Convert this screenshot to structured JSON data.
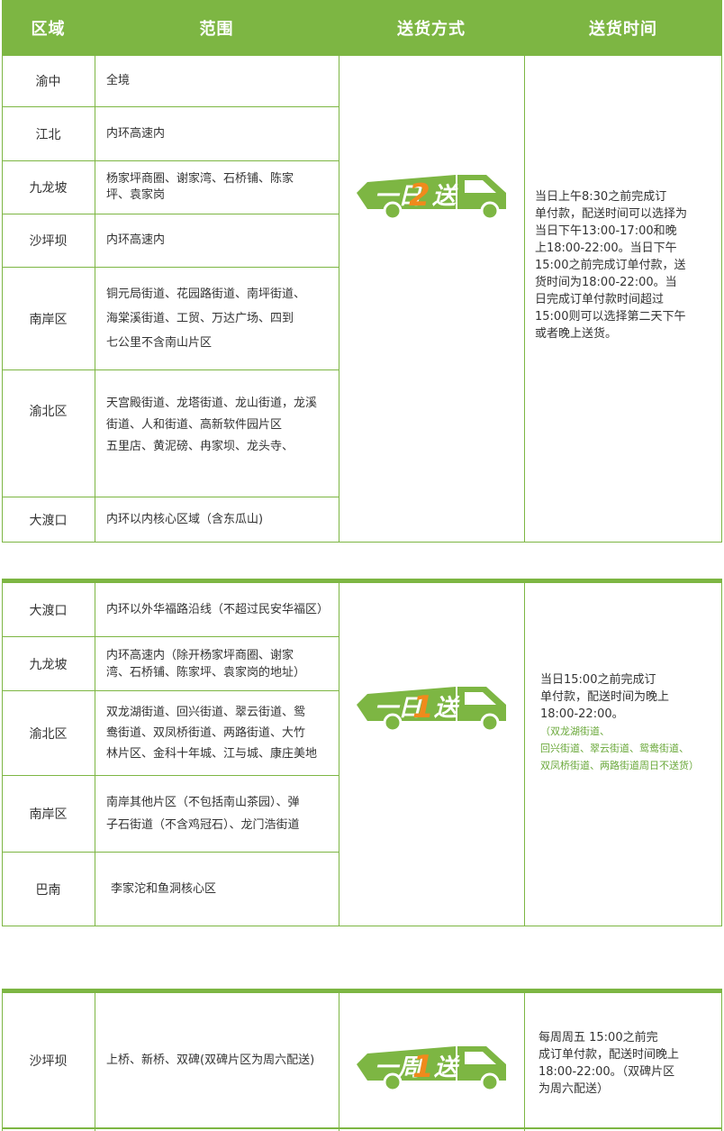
{
  "headers": [
    "区域",
    "范围",
    "送货方式",
    "送货时间"
  ],
  "section1": {
    "rows": [
      {
        "region": "渝中",
        "scope": "全境"
      },
      {
        "region": "江北",
        "scope": "内环高速内"
      },
      {
        "region": "九龙坡",
        "scope": "杨家坪商圈、谢家湾、石桥铺、陈家\n坪、袁家岗"
      },
      {
        "region": "沙坪坝",
        "scope": "内环高速内"
      },
      {
        "region": "南岸区",
        "scope": "铜元局街道、花园路街道、南坪街道、\n海棠溪街道、工贸、万达广场、四到\n七公里不含南山片区"
      },
      {
        "region": "渝北区",
        "scope": "天宫殿街道、龙塔街道、龙山街道，龙溪\n街道、人和街道、高新软件园片区\n五里店、黄泥磅、冉家坝、龙头寺、"
      },
      {
        "region": "大渡口",
        "scope": "内环以内核心区域（含东瓜山)"
      }
    ],
    "badge": {
      "prefix": "一日",
      "number": "2",
      "suffix": "送"
    },
    "time": "    当日上午8:30之前完成订\n单付款，配送时间可以选择为\n当日下午13:00-17:00和晚\n上18:00-22:00。当日下午\n15:00之前完成订单付款，送\n货时间为18:00-22:00。当\n日完成订单付款时间超过\n15:00则可以选择第二天下午\n或者晚上送货。"
  },
  "section2": {
    "rows": [
      {
        "region": "大渡口",
        "scope": "内环以外华福路沿线（不超过民安华福区）"
      },
      {
        "region": "九龙坡",
        "scope": "内环高速内（除开杨家坪商圈、谢家\n湾、石桥铺、陈家坪、袁家岗的地址）"
      },
      {
        "region": "渝北区",
        "scope": "双龙湖街道、回兴街道、翠云街道、鸳\n鸯街道、双凤桥街道、两路街道、大竹\n林片区、金科十年城、江与城、康庄美地"
      },
      {
        "region": "南岸区",
        "scope": "南岸其他片区（不包括南山茶园）、弹\n子石街道（不含鸡冠石）、龙门浩街道"
      },
      {
        "region": "巴南",
        "scope": "李家沱和鱼洞核心区"
      }
    ],
    "badge": {
      "prefix": "一日",
      "number": "1",
      "suffix": "送"
    },
    "time": "    当日15:00之前完成订\n单付款，配送时间为晚上\n18:00-22:00。",
    "time_note": "（双龙湖街道、\n回兴街道、翠云街道、鸳鸯街道、\n双凤桥街道、两路街道周日不送货）"
  },
  "section3": {
    "rows": [
      {
        "region": "沙坪坝",
        "scope": "上桥、新桥、双碑(双碑片区为周六配送)"
      }
    ],
    "badge": {
      "prefix": "一周",
      "number": "1",
      "suffix": "送"
    },
    "time": "    每周周五 15:00之前完\n成订单付款，配送时间晚上\n18:00-22:00。（双碑片区\n为周六配送）"
  },
  "colors": {
    "green": "#7db643",
    "orange": "#f08a1c",
    "text": "#333333",
    "note": "#6aa83a"
  },
  "icons": [
    "delivery-truck-icon"
  ]
}
